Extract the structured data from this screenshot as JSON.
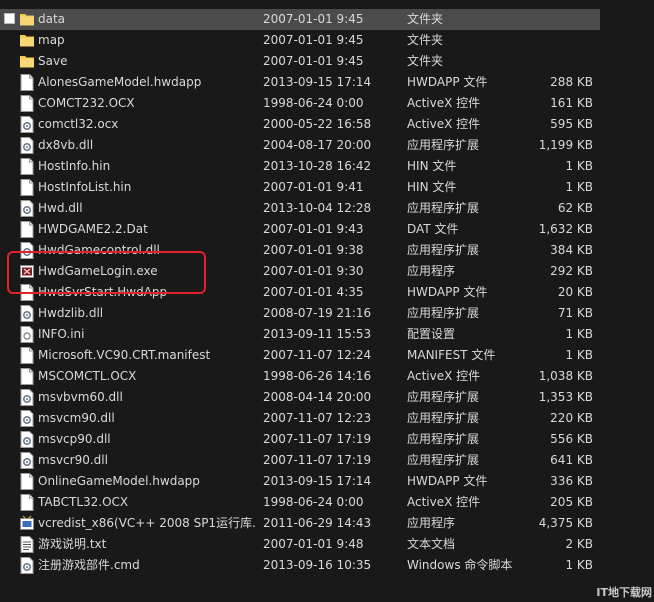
{
  "files": [
    {
      "name": "data",
      "date": "2007-01-01 9:45",
      "type": "文件夹",
      "size": "",
      "icon": "folder-icon",
      "selected": true
    },
    {
      "name": "map",
      "date": "2007-01-01 9:45",
      "type": "文件夹",
      "size": "",
      "icon": "folder-icon"
    },
    {
      "name": "Save",
      "date": "2007-01-01 9:45",
      "type": "文件夹",
      "size": "",
      "icon": "folder-icon"
    },
    {
      "name": "AlonesGameModel.hwdapp",
      "date": "2013-09-15 17:14",
      "type": "HWDAPP 文件",
      "size": "288 KB",
      "icon": "file-icon"
    },
    {
      "name": "COMCT232.OCX",
      "date": "1998-06-24 0:00",
      "type": "ActiveX 控件",
      "size": "161 KB",
      "icon": "file-icon"
    },
    {
      "name": "comctl32.ocx",
      "date": "2000-05-22 16:58",
      "type": "ActiveX 控件",
      "size": "595 KB",
      "icon": "gear-file-icon"
    },
    {
      "name": "dx8vb.dll",
      "date": "2004-08-17 20:00",
      "type": "应用程序扩展",
      "size": "1,199 KB",
      "icon": "gear-file-icon"
    },
    {
      "name": "HostInfo.hin",
      "date": "2013-10-28 16:42",
      "type": "HIN 文件",
      "size": "1 KB",
      "icon": "file-icon"
    },
    {
      "name": "HostInfoList.hin",
      "date": "2007-01-01 9:41",
      "type": "HIN 文件",
      "size": "1 KB",
      "icon": "file-icon"
    },
    {
      "name": "Hwd.dll",
      "date": "2013-10-04 12:28",
      "type": "应用程序扩展",
      "size": "62 KB",
      "icon": "gear-file-icon"
    },
    {
      "name": "HWDGAME2.2.Dat",
      "date": "2007-01-01 9:43",
      "type": "DAT 文件",
      "size": "1,632 KB",
      "icon": "file-icon"
    },
    {
      "name": "HwdGamecontrol.dll",
      "date": "2007-01-01 9:38",
      "type": "应用程序扩展",
      "size": "384 KB",
      "icon": "gear-file-icon"
    },
    {
      "name": "HwdGameLogin.exe",
      "date": "2007-01-01 9:30",
      "type": "应用程序",
      "size": "292 KB",
      "icon": "exe-icon"
    },
    {
      "name": "HwdSvrStart.HwdApp",
      "date": "2007-01-01 4:35",
      "type": "HWDAPP 文件",
      "size": "20 KB",
      "icon": "file-icon"
    },
    {
      "name": "Hwdzlib.dll",
      "date": "2008-07-19 21:16",
      "type": "应用程序扩展",
      "size": "71 KB",
      "icon": "gear-file-icon"
    },
    {
      "name": "INFO.ini",
      "date": "2013-09-11 15:53",
      "type": "配置设置",
      "size": "1 KB",
      "icon": "ini-icon"
    },
    {
      "name": "Microsoft.VC90.CRT.manifest",
      "date": "2007-11-07 12:24",
      "type": "MANIFEST 文件",
      "size": "1 KB",
      "icon": "file-icon"
    },
    {
      "name": "MSCOMCTL.OCX",
      "date": "1998-06-26 14:16",
      "type": "ActiveX 控件",
      "size": "1,038 KB",
      "icon": "file-icon"
    },
    {
      "name": "msvbvm60.dll",
      "date": "2008-04-14 20:00",
      "type": "应用程序扩展",
      "size": "1,353 KB",
      "icon": "gear-file-icon"
    },
    {
      "name": "msvcm90.dll",
      "date": "2007-11-07 12:23",
      "type": "应用程序扩展",
      "size": "220 KB",
      "icon": "gear-file-icon"
    },
    {
      "name": "msvcp90.dll",
      "date": "2007-11-07 17:19",
      "type": "应用程序扩展",
      "size": "556 KB",
      "icon": "gear-file-icon"
    },
    {
      "name": "msvcr90.dll",
      "date": "2007-11-07 17:19",
      "type": "应用程序扩展",
      "size": "641 KB",
      "icon": "gear-file-icon"
    },
    {
      "name": "OnlineGameModel.hwdapp",
      "date": "2013-09-15 17:14",
      "type": "HWDAPP 文件",
      "size": "336 KB",
      "icon": "file-icon"
    },
    {
      "name": "TABCTL32.OCX",
      "date": "1998-06-24 0:00",
      "type": "ActiveX 控件",
      "size": "205 KB",
      "icon": "file-icon"
    },
    {
      "name": "vcredist_x86(VC++ 2008 SP1运行库...",
      "date": "2011-06-29 14:43",
      "type": "应用程序",
      "size": "4,375 KB",
      "icon": "installer-icon"
    },
    {
      "name": "游戏说明.txt",
      "date": "2007-01-01 9:48",
      "type": "文本文档",
      "size": "2 KB",
      "icon": "text-file-icon"
    },
    {
      "name": "注册游戏部件.cmd",
      "date": "2013-09-16 10:35",
      "type": "Windows 命令脚本",
      "size": "1 KB",
      "icon": "gear-file-icon"
    }
  ],
  "watermark": "IT地下载网",
  "colors": {
    "background": "#191919",
    "text": "#d9d9d9",
    "selected_row": "#4b4b4b",
    "highlight_border": "#e0222a",
    "folder": "#f2c94c"
  }
}
